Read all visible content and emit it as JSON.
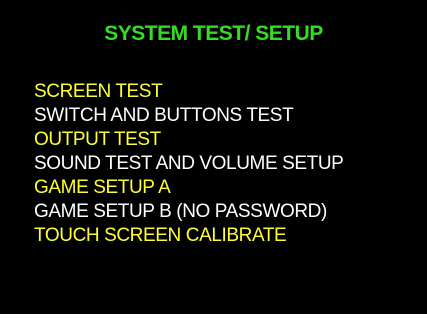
{
  "colors": {
    "background": "#000000",
    "title": "#33dd22",
    "item_yellow": "#ffff33",
    "item_white": "#ffffff"
  },
  "title": "SYSTEM TEST/ SETUP",
  "menu": [
    {
      "label": "SCREEN TEST",
      "color": "#ffff33"
    },
    {
      "label": "SWITCH AND BUTTONS TEST",
      "color": "#ffffff"
    },
    {
      "label": "OUTPUT TEST",
      "color": "#ffff33"
    },
    {
      "label": "SOUND TEST AND VOLUME SETUP",
      "color": "#ffffff"
    },
    {
      "label": "GAME SETUP A",
      "color": "#ffff33"
    },
    {
      "label": "GAME SETUP B (NO PASSWORD)",
      "color": "#ffffff"
    },
    {
      "label": "TOUCH SCREEN CALIBRATE",
      "color": "#ffff33"
    }
  ]
}
